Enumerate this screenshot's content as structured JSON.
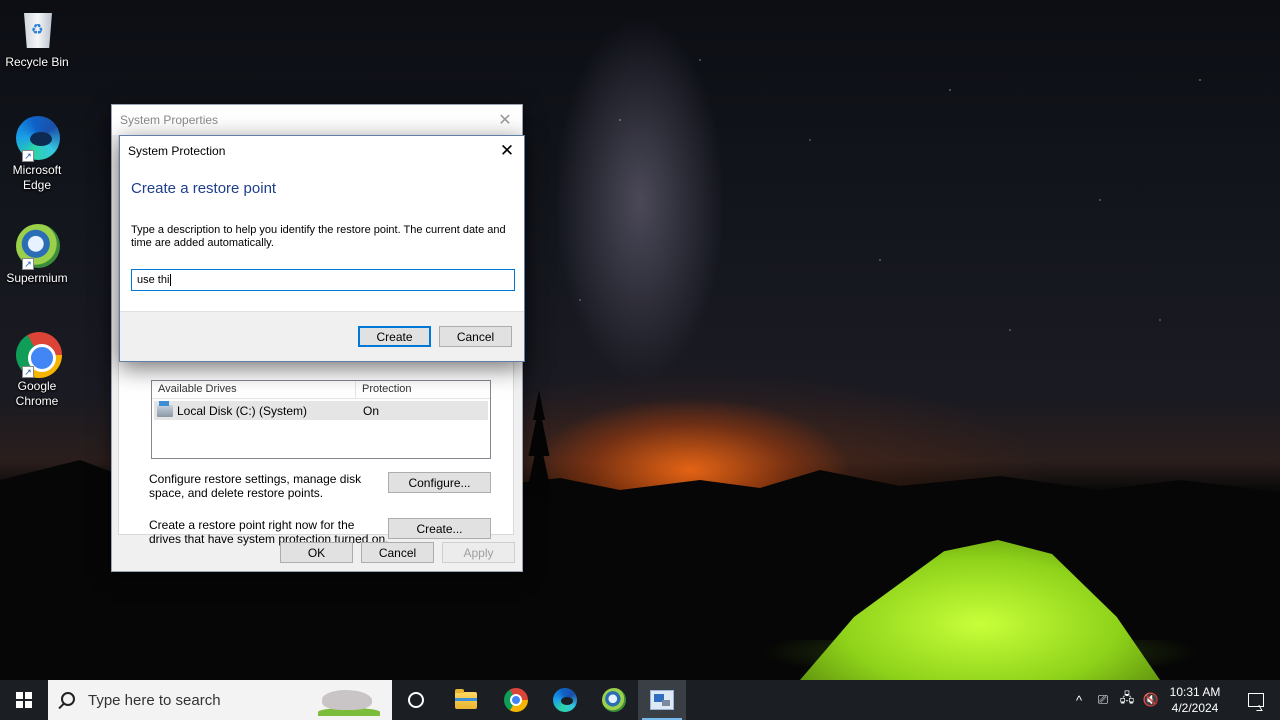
{
  "desktop": {
    "icons": [
      {
        "label": "Recycle Bin",
        "icon": "recycle-bin-icon"
      },
      {
        "label": "Microsoft Edge",
        "icon": "edge-icon"
      },
      {
        "label": "Supermium",
        "icon": "supermium-icon"
      },
      {
        "label": "Google Chrome",
        "icon": "chrome-icon"
      }
    ]
  },
  "system_properties": {
    "title": "System Properties",
    "drives_header": {
      "col1": "Available Drives",
      "col2": "Protection"
    },
    "drives": [
      {
        "name": "Local Disk (C:) (System)",
        "protection": "On"
      }
    ],
    "configure_text": "Configure restore settings, manage disk space, and delete restore points.",
    "configure_label": "Configure...",
    "create_text": "Create a restore point right now for the drives that have system protection turned on.",
    "create_label": "Create...",
    "ok_label": "OK",
    "cancel_label": "Cancel",
    "apply_label": "Apply"
  },
  "system_protection": {
    "title": "System Protection",
    "heading": "Create a restore point",
    "instructions": "Type a description to help you identify the restore point. The current date and time are added automatically.",
    "input_value": "use thi",
    "create_label": "Create",
    "cancel_label": "Cancel"
  },
  "taskbar": {
    "search_placeholder": "Type here to search",
    "time": "10:31 AM",
    "date": "4/2/2024",
    "tray_chevron": "^"
  }
}
